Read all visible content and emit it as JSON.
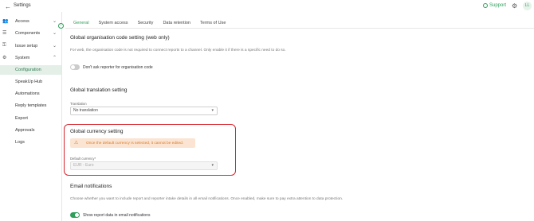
{
  "header": {
    "back_icon": "arrow-left-icon",
    "title": "Settings",
    "support_label": "Support",
    "avatar_initials": "LL"
  },
  "sidebar": {
    "items": [
      {
        "label": "Access",
        "icon": "users-icon",
        "chevron": "chevron-down"
      },
      {
        "label": "Components",
        "icon": "layers-icon",
        "chevron": "chevron-down"
      },
      {
        "label": "Issue setup",
        "icon": "key-icon",
        "chevron": "chevron-down"
      },
      {
        "label": "System",
        "icon": "gear-icon",
        "chevron": "chevron-up"
      }
    ],
    "system_children": [
      {
        "label": "Configuration",
        "active": true
      },
      {
        "label": "SpeakUp Hub"
      },
      {
        "label": "Automations"
      },
      {
        "label": "Reply templates"
      },
      {
        "label": "Export"
      },
      {
        "label": "Approvals"
      },
      {
        "label": "Logs"
      }
    ]
  },
  "tabs": [
    {
      "label": "General",
      "active": true
    },
    {
      "label": "System access"
    },
    {
      "label": "Security"
    },
    {
      "label": "Data retention"
    },
    {
      "label": "Terms of Use"
    }
  ],
  "sections": {
    "org_code": {
      "title": "Global organisation code setting (web only)",
      "description": "For web, the organisation code is not required to connect reports to a channel. Only enable it if there is a specific need to do so.",
      "toggle_label": "Don't ask reporter for organisation code",
      "toggle_on": false
    },
    "translation": {
      "title": "Global translation setting",
      "field_label": "Translation",
      "value": "No translation"
    },
    "currency": {
      "title": "Global currency setting",
      "warning": "Once the default currency is selected, it cannot be edited.",
      "field_label": "Default currency*",
      "value": "EUR - Euro"
    },
    "email": {
      "title": "Email notifications",
      "description": "Choose whether you want to include report and reporter intake details in all email notifications. Once enabled, make sure to pay extra attention to data protection.",
      "toggle_label": "Show report data in email notifications",
      "toggle_on": true
    }
  },
  "colors": {
    "accent": "#2e9e5b",
    "highlight_border": "#d8252e",
    "warning_bg": "#fbe5d2",
    "warning_text": "#d97a2a"
  }
}
